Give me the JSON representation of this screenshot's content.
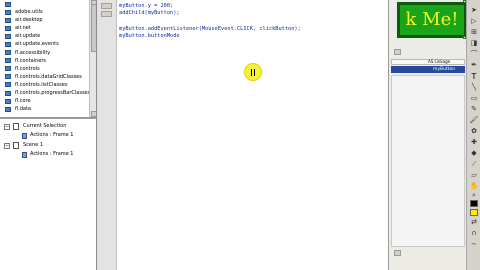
{
  "package_tree": {
    "items": [
      "",
      "adobe.utils",
      "air.desktop",
      "air.net",
      "air.update",
      "air.update.events",
      "fl.accessibility",
      "fl.containers",
      "fl.controls",
      "fl.controls.dataGridClasses",
      "fl.controls.listClasses",
      "fl.controls.progressBarClasses",
      "fl.core",
      "fl.data"
    ]
  },
  "scene_panel": {
    "current_selection": "Current Selection",
    "current_actions": "Actions : Frame 1",
    "scene": "Scene 1",
    "scene_actions": "Actions : Frame 1"
  },
  "code": {
    "lines": [
      "myButton.y = 200;",
      "addChild(myButton);",
      "",
      "myButton.addEventListener(MouseEvent.CLICK, clickButton);",
      "myButton.buttonMode"
    ]
  },
  "stage": {
    "button_text": "k Me!"
  },
  "library": {
    "dropdown_label": "AS Linkage",
    "selected_item": "myButton"
  },
  "colors": {
    "code": "#0b26a8",
    "stage_button": "#19a41a",
    "stage_text": "#f4f428",
    "cursor_highlight": "#f6f23a"
  }
}
